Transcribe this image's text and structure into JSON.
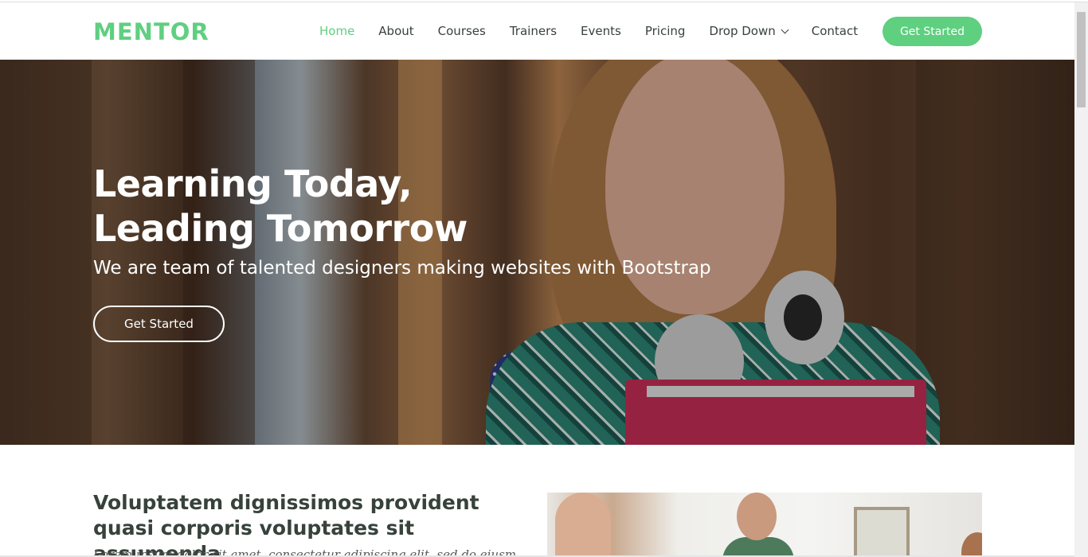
{
  "brand": {
    "logo": "MENTOR",
    "accent_color": "#5fcf80"
  },
  "nav": {
    "items": [
      {
        "label": "Home",
        "active": true
      },
      {
        "label": "About",
        "active": false
      },
      {
        "label": "Courses",
        "active": false
      },
      {
        "label": "Trainers",
        "active": false
      },
      {
        "label": "Events",
        "active": false
      },
      {
        "label": "Pricing",
        "active": false
      },
      {
        "label": "Drop Down",
        "active": false,
        "icon": "chevron-down-icon"
      },
      {
        "label": "Contact",
        "active": false
      }
    ],
    "cta_label": "Get Started"
  },
  "hero": {
    "title_line1": "Learning Today,",
    "title_line2": "Leading Tomorrow",
    "subtitle": "We are team of talented designers making websites with Bootstrap",
    "button_label": "Get Started"
  },
  "about": {
    "title": "Voluptatem dignissimos provident quasi corporis voluptates sit assumenda.",
    "text": "Lorem ipsum dolor sit amet, consectetur adipiscing elit, sed do eiusmod"
  }
}
